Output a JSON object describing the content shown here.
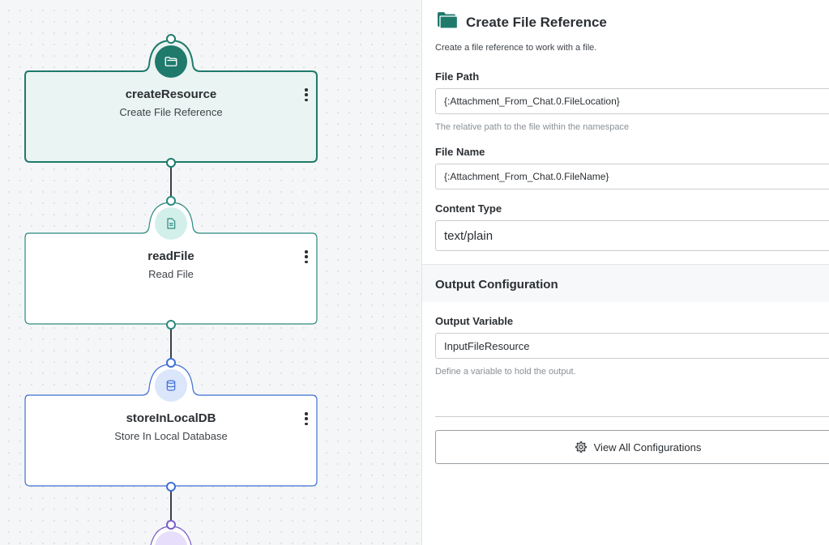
{
  "nodes": [
    {
      "title": "createResource",
      "subtitle": "Create File Reference",
      "icon": "folder-icon",
      "color": "#1f7a6c"
    },
    {
      "title": "readFile",
      "subtitle": "Read File",
      "icon": "document-icon",
      "color": "#2a8a80"
    },
    {
      "title": "storeInLocalDB",
      "subtitle": "Store In Local Database",
      "icon": "database-icon",
      "color": "#3f6fd6"
    },
    {
      "icon": "partial-node-icon",
      "color": "#7a5cc7"
    }
  ],
  "panel": {
    "title": "Create File Reference",
    "header_icon": "folder-icon",
    "description": "Create a file reference to work with a file.",
    "file_path": {
      "label": "File Path",
      "value": "{:Attachment_From_Chat.0.FileLocation}",
      "help": "The relative path to the file within the namespace"
    },
    "file_name": {
      "label": "File Name",
      "value": "{:Attachment_From_Chat.0.FileName}"
    },
    "content_type": {
      "label": "Content Type",
      "value": "text/plain"
    },
    "output_section": {
      "title": "Output Configuration"
    },
    "output_variable": {
      "label": "Output Variable",
      "value": "InputFileResource",
      "help": "Define a variable to hold the output."
    },
    "view_all_button": {
      "label": "View All Configurations",
      "icon": "gear-icon"
    }
  },
  "colors": {
    "selected_node_bg": "#eaf4f2",
    "teal": "#1f7a6c",
    "blue": "#3f6fd6",
    "purple": "#7a5cc7"
  }
}
